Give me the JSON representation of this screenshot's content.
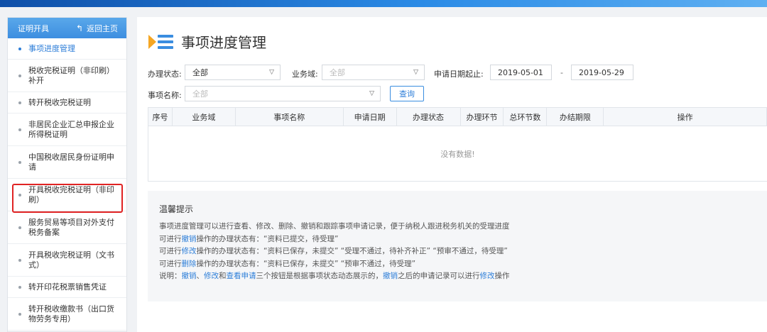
{
  "sidebar": {
    "header_title": "证明开具",
    "home_label": "返回主页",
    "items": [
      {
        "label": "事项进度管理"
      },
      {
        "label": "税收完税证明（非印刷）补开"
      },
      {
        "label": "转开税收完税证明"
      },
      {
        "label": "非居民企业汇总申报企业所得税证明"
      },
      {
        "label": "中国税收居民身份证明申请"
      },
      {
        "label": "开具税收完税证明（非印刷）"
      },
      {
        "label": "服务贸易等项目对外支付税务备案"
      },
      {
        "label": "开具税收完税证明（文书式）"
      },
      {
        "label": "转开印花税票销售凭证"
      },
      {
        "label": "转开税收缴款书（出口货物劳务专用）"
      }
    ]
  },
  "main": {
    "title": "事项进度管理",
    "form": {
      "status_label": "办理状态:",
      "status_value": "全部",
      "domain_label": "业务域:",
      "domain_placeholder": "全部",
      "date_label": "申请日期起止:",
      "date_start": "2019-05-01",
      "date_sep": "-",
      "date_end": "2019-05-29",
      "item_label": "事项名称:",
      "item_placeholder": "全部",
      "query_label": "查询"
    },
    "table": {
      "headers": [
        "序号",
        "业务域",
        "事项名称",
        "申请日期",
        "办理状态",
        "办理环节",
        "总环节数",
        "办结期限",
        "操作"
      ],
      "empty_text": "没有数据!"
    },
    "tips": {
      "title": "温馨提示",
      "line1": "事项进度管理可以进行查看、修改、删除、撤销和跟踪事项申请记录，便于纳税人跟进税务机关的受理进度",
      "line2_pre": "可进行",
      "line2_link": "撤销",
      "line2_post": "操作的办理状态有：“资料已提交，待受理”",
      "line3_pre": "可进行",
      "line3_link": "修改",
      "line3_post": "操作的办理状态有：“资料已保存，未提交” “受理不通过，待补齐补正” “预审不通过，待受理”",
      "line4_pre": "可进行",
      "line4_link": "删除",
      "line4_post": "操作的办理状态有：“资料已保存，未提交” “预审不通过，待受理”",
      "line5_a": "说明：",
      "line5_link1": "撤销",
      "line5_b": "、",
      "line5_link2": "修改",
      "line5_c": "和",
      "line5_link3": "查看申请",
      "line5_d": "三个按钮是根据事项状态动态展示的，",
      "line5_link4": "撤销",
      "line5_e": "之后的申请记录可以进行",
      "line5_link5": "修改",
      "line5_f": "操作"
    }
  },
  "icons": {
    "home": "back-arrow-icon",
    "dropdown": "chevron-down-icon",
    "title": "progress-list-icon"
  },
  "colors": {
    "accent": "#2d7ed8",
    "highlight": "#e02323",
    "title_icon_orange": "#f5a623"
  }
}
